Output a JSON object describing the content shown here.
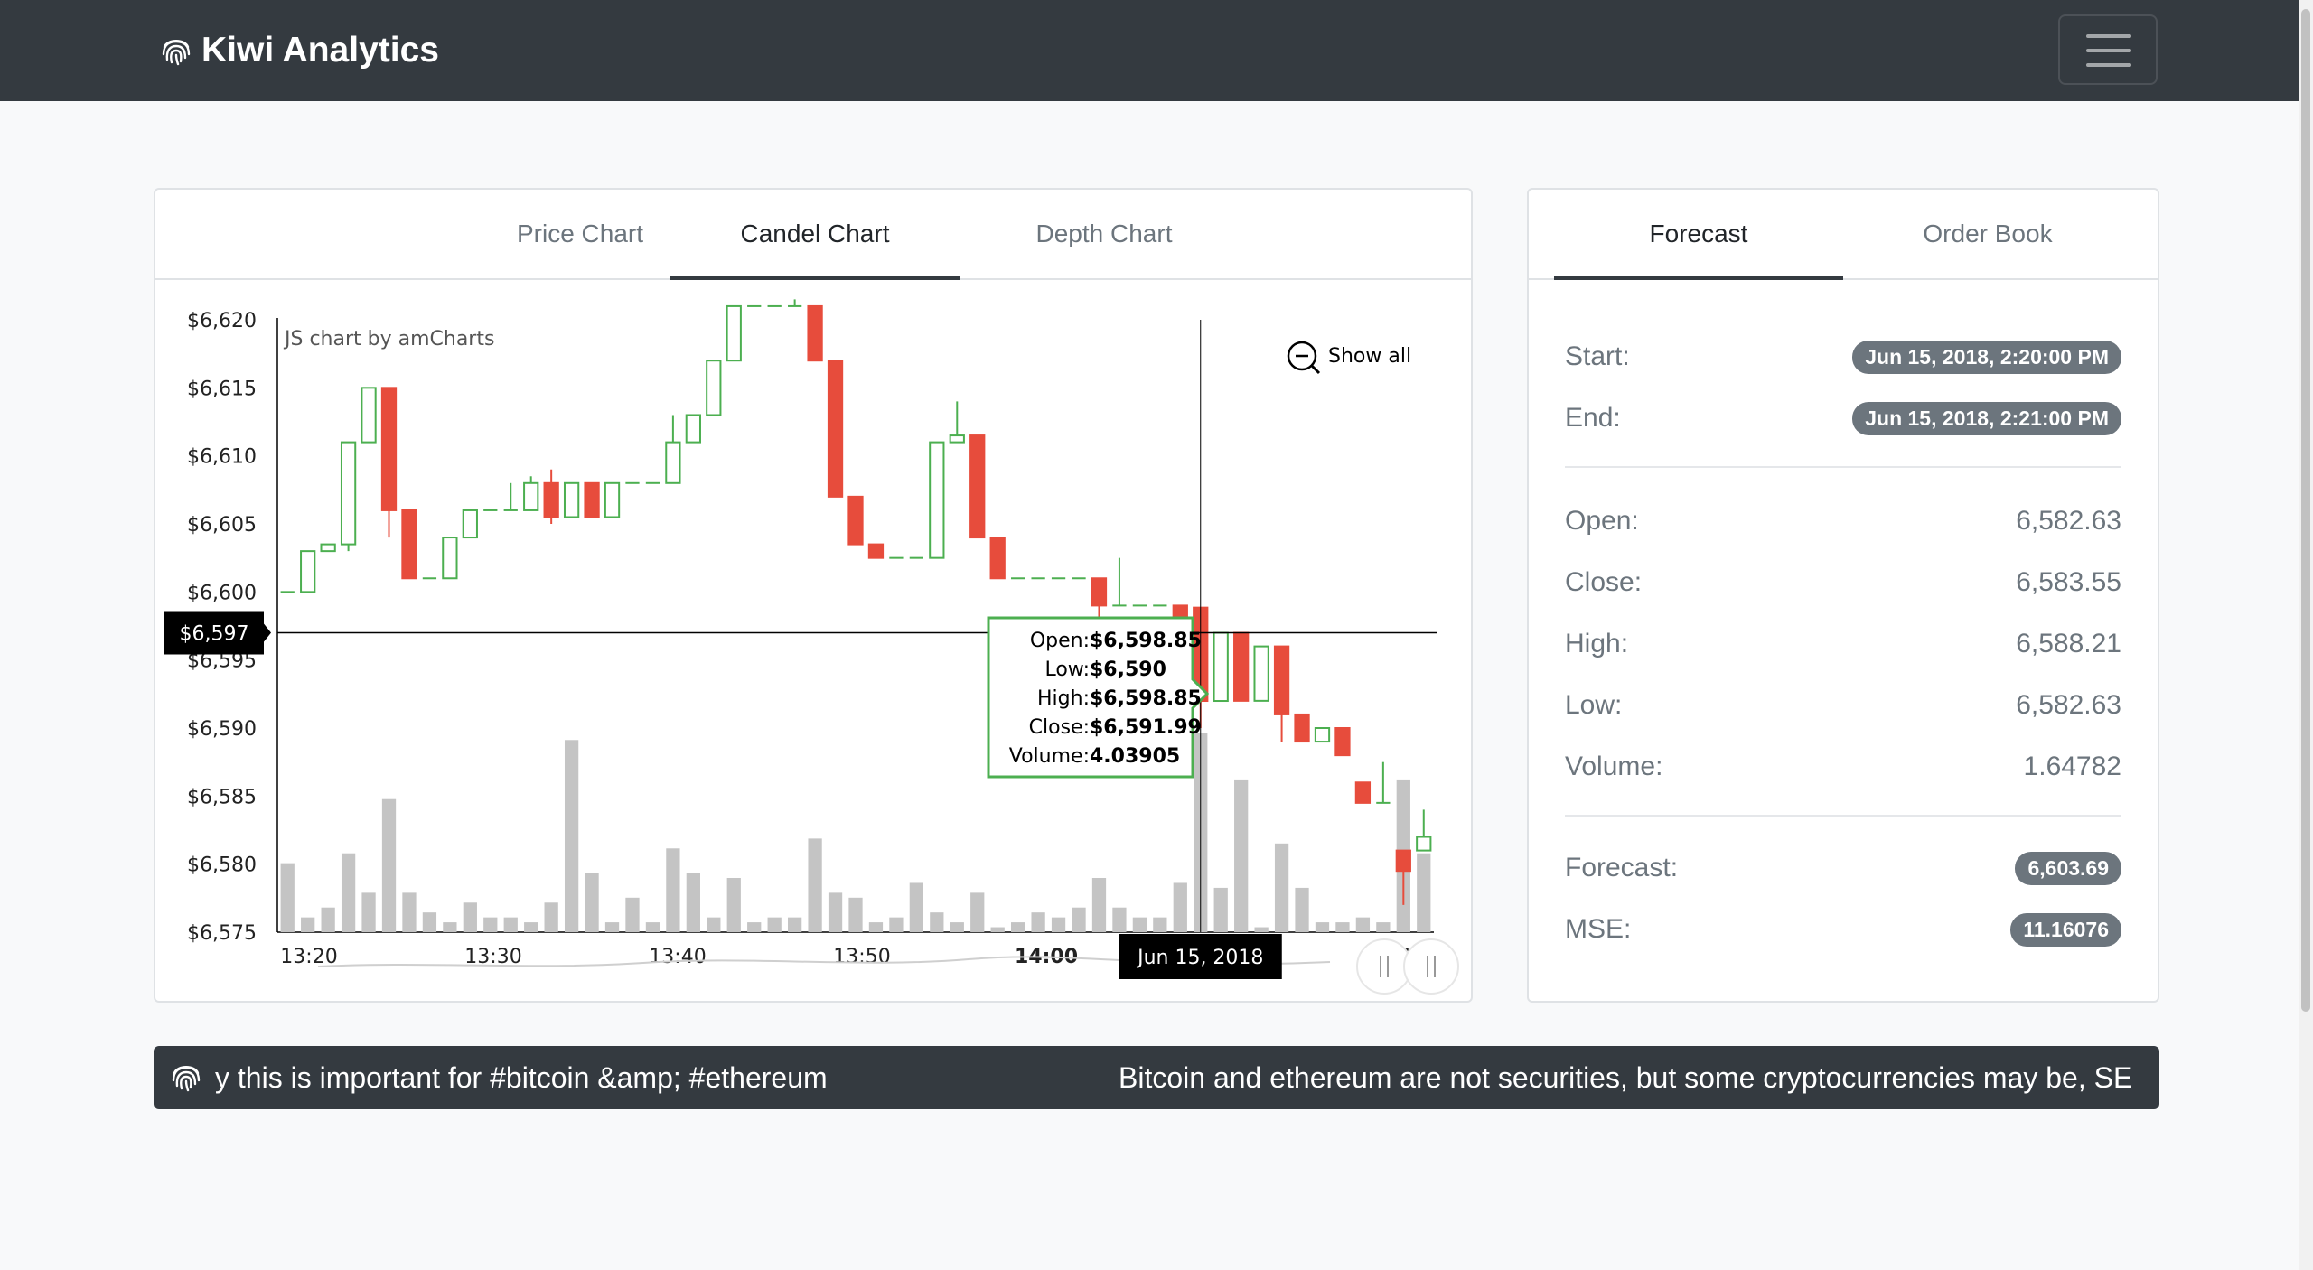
{
  "navbar": {
    "brand": "Kiwi Analytics",
    "menu_icon": "hamburger-icon"
  },
  "chart_tabs": [
    {
      "label": "Price Chart",
      "active": false
    },
    {
      "label": "Candel Chart",
      "active": true
    },
    {
      "label": "Depth Chart",
      "active": false
    }
  ],
  "chart_data": {
    "type": "candlestick",
    "credit": "JS chart by amCharts",
    "show_all_label": "Show all",
    "y_ticks": [
      "$6,620",
      "$6,615",
      "$6,610",
      "$6,605",
      "$6,600",
      "$6,595",
      "$6,590",
      "$6,585",
      "$6,580",
      "$6,575"
    ],
    "ylim": [
      6575,
      6620
    ],
    "x_ticks": [
      {
        "label": "13:20",
        "bold": false
      },
      {
        "label": "13:30",
        "bold": false
      },
      {
        "label": "13:40",
        "bold": false
      },
      {
        "label": "13:50",
        "bold": false
      },
      {
        "label": "14:00",
        "bold": true
      },
      {
        "label": "14:20",
        "bold": false
      }
    ],
    "candles": [
      [
        6600,
        6600,
        6600,
        6600,
        1.4
      ],
      [
        6600,
        6603,
        6600,
        6603,
        0.3
      ],
      [
        6603,
        6603.5,
        6603,
        6603.5,
        0.5
      ],
      [
        6603.5,
        6611,
        6603,
        6611,
        1.6
      ],
      [
        6611,
        6615,
        6611,
        6615,
        0.8
      ],
      [
        6615,
        6606,
        6604,
        6615,
        2.7
      ],
      [
        6606,
        6601,
        6601,
        6606,
        0.8
      ],
      [
        6601,
        6601,
        6601,
        6601,
        0.4
      ],
      [
        6601,
        6604,
        6601,
        6604,
        0.2
      ],
      [
        6604,
        6606,
        6604,
        6606,
        0.6
      ],
      [
        6606,
        6606,
        6606,
        6606,
        0.3
      ],
      [
        6606,
        6606,
        6606,
        6608,
        0.3
      ],
      [
        6606,
        6608,
        6606,
        6608.5,
        0.2
      ],
      [
        6608,
        6605.5,
        6605,
        6609,
        0.6
      ],
      [
        6605.5,
        6608,
        6605.5,
        6608,
        3.9
      ],
      [
        6608,
        6605.5,
        6605.5,
        6608,
        1.2
      ],
      [
        6605.5,
        6608,
        6605.5,
        6608,
        0.2
      ],
      [
        6608,
        6608,
        6608,
        6608,
        0.7
      ],
      [
        6608,
        6608,
        6608,
        6608,
        0.2
      ],
      [
        6608,
        6611,
        6608,
        6613,
        1.7
      ],
      [
        6611,
        6613,
        6611,
        6613,
        1.2
      ],
      [
        6613,
        6617,
        6613,
        6617,
        0.3
      ],
      [
        6617,
        6621,
        6617,
        6621,
        1.1
      ],
      [
        6621,
        6621,
        6621,
        6621,
        0.2
      ],
      [
        6621,
        6621,
        6621,
        6621,
        0.3
      ],
      [
        6621,
        6621,
        6621,
        6621.5,
        0.3
      ],
      [
        6621,
        6617,
        6617,
        6621,
        1.9
      ],
      [
        6617,
        6607,
        6607,
        6617,
        0.8
      ],
      [
        6607,
        6603.5,
        6603.5,
        6607,
        0.7
      ],
      [
        6603.5,
        6602.5,
        6602.5,
        6603.5,
        0.2
      ],
      [
        6602.5,
        6602.5,
        6602.5,
        6602.5,
        0.3
      ],
      [
        6602.5,
        6602.5,
        6602.5,
        6602.5,
        1.0
      ],
      [
        6602.5,
        6611,
        6602.5,
        6611,
        0.4
      ],
      [
        6611,
        6611.5,
        6611,
        6614,
        0.2
      ],
      [
        6611.5,
        6604,
        6604,
        6611.5,
        0.8
      ],
      [
        6604,
        6601,
        6601,
        6604,
        0.1
      ],
      [
        6601,
        6601,
        6601,
        6601,
        0.2
      ],
      [
        6601,
        6601,
        6601,
        6601,
        0.4
      ],
      [
        6601,
        6601,
        6601,
        6601,
        0.3
      ],
      [
        6601,
        6601,
        6601,
        6601,
        0.5
      ],
      [
        6601,
        6599,
        6598,
        6601,
        1.1
      ],
      [
        6599,
        6599,
        6599,
        6602.5,
        0.5
      ],
      [
        6599,
        6599,
        6599,
        6599,
        0.3
      ],
      [
        6599,
        6599,
        6599,
        6599,
        0.3
      ],
      [
        6599,
        6598,
        6593,
        6599,
        1.0
      ],
      [
        6598.85,
        6591.99,
        6590,
        6598.85,
        4.04
      ],
      [
        6591.99,
        6597,
        6591.99,
        6597,
        0.9
      ],
      [
        6597,
        6592,
        6592,
        6597,
        3.1
      ],
      [
        6592,
        6596,
        6592,
        6596,
        0.1
      ],
      [
        6596,
        6591,
        6589,
        6596,
        1.8
      ],
      [
        6591,
        6589,
        6589,
        6591,
        0.9
      ],
      [
        6589,
        6590,
        6589,
        6590,
        0.2
      ],
      [
        6590,
        6588,
        6588,
        6590,
        0.2
      ],
      [
        6586,
        6584.5,
        6584.5,
        6586,
        0.3
      ],
      [
        6584.5,
        6584.5,
        6584.5,
        6587.5,
        0.2
      ],
      [
        6581,
        6579.5,
        6577,
        6581,
        3.1
      ],
      [
        6581,
        6582,
        6581,
        6584,
        1.6
      ]
    ],
    "crosshair": {
      "price_label": "$6,597",
      "date_label": "Jun 15, 2018"
    },
    "tooltip": [
      {
        "label": "Open:",
        "value": "$6,598.85"
      },
      {
        "label": "Low:",
        "value": "$6,590"
      },
      {
        "label": "High:",
        "value": "$6,598.85"
      },
      {
        "label": "Close:",
        "value": "$6,591.99"
      },
      {
        "label": "Volume:",
        "value": "4.03905"
      }
    ],
    "colors": {
      "up": "#4caf50",
      "down": "#e74c3c",
      "volume": "#c4c4c4",
      "tooltip_border": "#4caf50"
    }
  },
  "side_tabs": [
    {
      "label": "Forecast",
      "active": true
    },
    {
      "label": "Order Book",
      "active": false
    }
  ],
  "forecast": {
    "start_label": "Start:",
    "start_value": "Jun 15, 2018, 2:20:00 PM",
    "end_label": "End:",
    "end_value": "Jun 15, 2018, 2:21:00 PM",
    "open_label": "Open:",
    "open_value": "6,582.63",
    "close_label": "Close:",
    "close_value": "6,583.55",
    "high_label": "High:",
    "high_value": "6,588.21",
    "low_label": "Low:",
    "low_value": "6,582.63",
    "volume_label": "Volume:",
    "volume_value": "1.64782",
    "forecast_label": "Forecast:",
    "forecast_value": "6,603.69",
    "mse_label": "MSE:",
    "mse_value": "11.16076"
  },
  "ticker": {
    "icon": "fingerprint-icon",
    "items": [
      "y this is important for #bitcoin &amp; #ethereum",
      "Bitcoin and ethereum are not securities, but some cryptocurrencies may be, SE"
    ]
  }
}
